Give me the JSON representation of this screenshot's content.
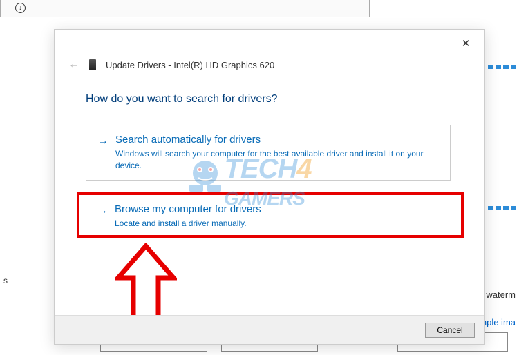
{
  "background": {
    "text_snippet_right": "waterm",
    "link_snippet": "nple ima",
    "side_char": "s"
  },
  "dialog": {
    "title": "Update Drivers - Intel(R) HD Graphics 620",
    "heading": "How do you want to search for drivers?",
    "option1": {
      "title": "Search automatically for drivers",
      "desc": "Windows will search your computer for the best available driver and install it on your device."
    },
    "option2": {
      "title": "Browse my computer for drivers",
      "desc": "Locate and install a driver manually."
    },
    "cancel": "Cancel"
  },
  "watermark": {
    "tech": "TECH",
    "four": "4",
    "gamers": "GAMERS"
  }
}
